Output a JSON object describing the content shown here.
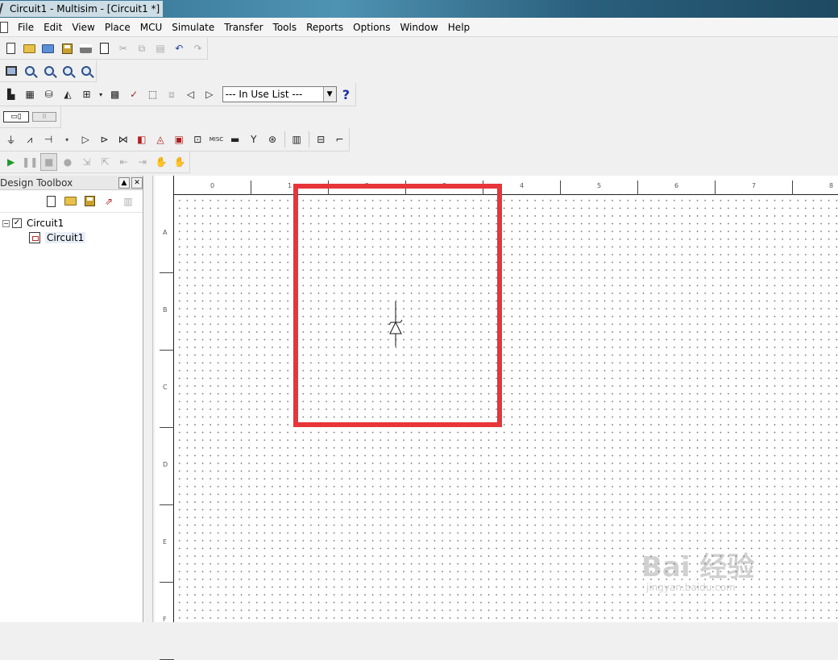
{
  "window": {
    "title": "Circuit1 - Multisim - [Circuit1 *]"
  },
  "menu": [
    "File",
    "Edit",
    "View",
    "Place",
    "MCU",
    "Simulate",
    "Transfer",
    "Tools",
    "Reports",
    "Options",
    "Window",
    "Help"
  ],
  "toolbar3": {
    "in_use_list": "--- In Use List ---",
    "help_label": "?"
  },
  "component_toolbar": {
    "misc_label": "MISC"
  },
  "toolbox": {
    "title": "Design Toolbox",
    "tree": [
      {
        "label": "Circuit1",
        "expander": "−",
        "checked": "✓"
      },
      {
        "label": "Circuit1"
      }
    ]
  },
  "rulers": {
    "top": [
      "0",
      "1",
      "2",
      "3",
      "4",
      "5",
      "6",
      "7",
      "8"
    ],
    "left": [
      "A",
      "B",
      "C",
      "D",
      "E",
      "F"
    ]
  },
  "watermark": {
    "main": "Bai 经验",
    "sub": "jingyan.baidu.com"
  },
  "colors": {
    "highlight": "#e8353a",
    "title_gradient": "#2f6c8e",
    "menubar": "#f5f5f5"
  }
}
